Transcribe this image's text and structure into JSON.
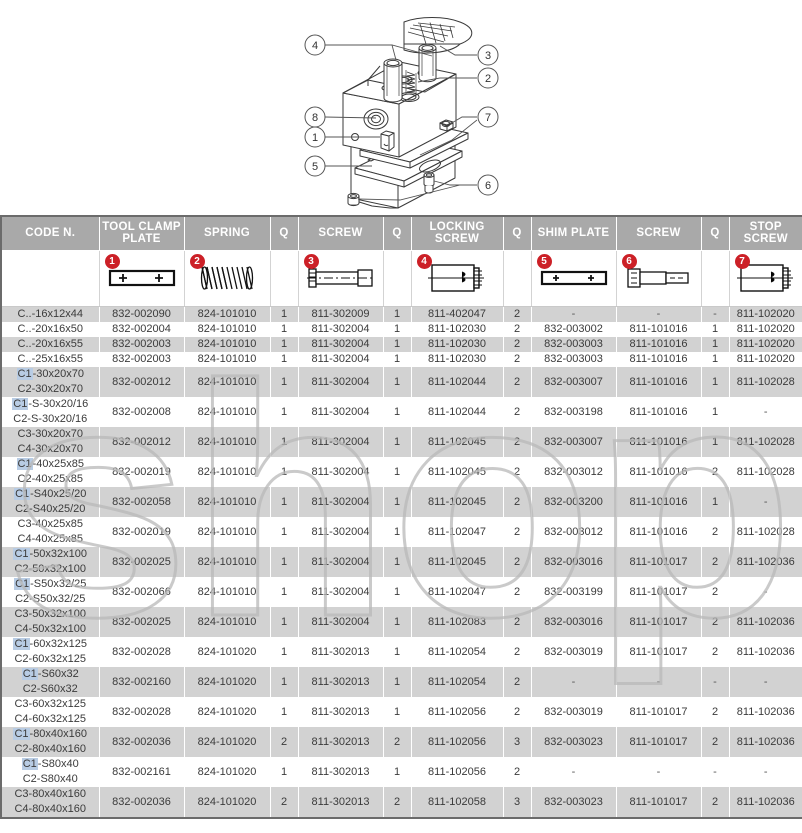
{
  "drawing": {
    "name": "tool-holder-assembly-exploded-view",
    "callouts": [
      "1",
      "2",
      "3",
      "4",
      "5",
      "6",
      "7",
      "8"
    ]
  },
  "watermark": {
    "text": "shop"
  },
  "table": {
    "columns": [
      {
        "label": "CODE N.",
        "badge": null,
        "icon": null
      },
      {
        "label": "TOOL CLAMP PLATE",
        "badge": "1",
        "icon": "clamp-plate-icon"
      },
      {
        "label": "SPRING",
        "badge": "2",
        "icon": "spring-icon"
      },
      {
        "label": "Q",
        "badge": null,
        "icon": null
      },
      {
        "label": "SCREW",
        "badge": "3",
        "icon": "screw-icon"
      },
      {
        "label": "Q",
        "badge": null,
        "icon": null
      },
      {
        "label": "LOCKING SCREW",
        "badge": "4",
        "icon": "locking-screw-icon"
      },
      {
        "label": "Q",
        "badge": null,
        "icon": null
      },
      {
        "label": "SHIM PLATE",
        "badge": "5",
        "icon": "shim-plate-icon"
      },
      {
        "label": "SCREW",
        "badge": "6",
        "icon": "socket-screw-icon"
      },
      {
        "label": "Q",
        "badge": null,
        "icon": null
      },
      {
        "label": "STOP SCREW",
        "badge": "7",
        "icon": "stop-screw-icon"
      }
    ],
    "rows": [
      {
        "codes": [
          "C..-16x12x44"
        ],
        "hl": false,
        "shaded": true,
        "tall": false,
        "cells": [
          "832-002090",
          "824-101010",
          "1",
          "811-302009",
          "1",
          "811-402047",
          "2",
          "-",
          "-",
          "-",
          "811-102020"
        ]
      },
      {
        "codes": [
          "C..-20x16x50"
        ],
        "hl": false,
        "shaded": false,
        "tall": false,
        "cells": [
          "832-002004",
          "824-101010",
          "1",
          "811-302004",
          "1",
          "811-102030",
          "2",
          "832-003002",
          "811-101016",
          "1",
          "811-102020"
        ]
      },
      {
        "codes": [
          "C..-20x16x55"
        ],
        "hl": false,
        "shaded": true,
        "tall": false,
        "cells": [
          "832-002003",
          "824-101010",
          "1",
          "811-302004",
          "1",
          "811-102030",
          "2",
          "832-003003",
          "811-101016",
          "1",
          "811-102020"
        ]
      },
      {
        "codes": [
          "C..-25x16x55"
        ],
        "hl": false,
        "shaded": false,
        "tall": false,
        "cells": [
          "832-002003",
          "824-101010",
          "1",
          "811-302004",
          "1",
          "811-102030",
          "2",
          "832-003003",
          "811-101016",
          "1",
          "811-102020"
        ]
      },
      {
        "codes": [
          "C1-30x20x70",
          "C2-30x20x70"
        ],
        "hl": true,
        "shaded": true,
        "tall": true,
        "cells": [
          "832-002012",
          "824-101010",
          "1",
          "811-302004",
          "1",
          "811-102044",
          "2",
          "832-003007",
          "811-101016",
          "1",
          "811-102028"
        ]
      },
      {
        "codes": [
          "C1-S-30x20/16",
          "C2-S-30x20/16"
        ],
        "hl": true,
        "shaded": false,
        "tall": true,
        "cells": [
          "832-002008",
          "824-101010",
          "1",
          "811-302004",
          "1",
          "811-102044",
          "2",
          "832-003198",
          "811-101016",
          "1",
          "-"
        ]
      },
      {
        "codes": [
          "C3-30x20x70",
          "C4-30x20x70"
        ],
        "hl": false,
        "shaded": true,
        "tall": true,
        "cells": [
          "832-002012",
          "824-101010",
          "1",
          "811-302004",
          "1",
          "811-102045",
          "2",
          "832-003007",
          "811-101016",
          "1",
          "811-102028"
        ]
      },
      {
        "codes": [
          "C1-40x25x85",
          "C2-40x25x85"
        ],
        "hl": true,
        "shaded": false,
        "tall": true,
        "cells": [
          "832-002019",
          "824-101010",
          "1",
          "811-302004",
          "1",
          "811-102045",
          "2",
          "832-003012",
          "811-101016",
          "2",
          "811-102028"
        ]
      },
      {
        "codes": [
          "C1-S40x25/20",
          "C2-S40x25/20"
        ],
        "hl": true,
        "shaded": true,
        "tall": true,
        "cells": [
          "832-002058",
          "824-101010",
          "1",
          "811-302004",
          "1",
          "811-102045",
          "2",
          "832-003200",
          "811-101016",
          "1",
          "-"
        ]
      },
      {
        "codes": [
          "C3-40x25x85",
          "C4-40x25x85"
        ],
        "hl": false,
        "shaded": false,
        "tall": true,
        "cells": [
          "832-002019",
          "824-101010",
          "1",
          "811-302004",
          "1",
          "811-102047",
          "2",
          "832-003012",
          "811-101016",
          "2",
          "811-102028"
        ]
      },
      {
        "codes": [
          "C1-50x32x100",
          "C2-50x32x100"
        ],
        "hl": true,
        "shaded": true,
        "tall": true,
        "cells": [
          "832-002025",
          "824-101010",
          "1",
          "811-302004",
          "1",
          "811-102045",
          "2",
          "832-003016",
          "811-101017",
          "2",
          "811-102036"
        ]
      },
      {
        "codes": [
          "C1-S50x32/25",
          "C2-S50x32/25"
        ],
        "hl": true,
        "shaded": false,
        "tall": true,
        "cells": [
          "832-002066",
          "824-101010",
          "1",
          "811-302004",
          "1",
          "811-102047",
          "2",
          "832-003199",
          "811-101017",
          "2",
          "-"
        ]
      },
      {
        "codes": [
          "C3-50x32x100",
          "C4-50x32x100"
        ],
        "hl": false,
        "shaded": true,
        "tall": true,
        "cells": [
          "832-002025",
          "824-101010",
          "1",
          "811-302004",
          "1",
          "811-102083",
          "2",
          "832-003016",
          "811-101017",
          "2",
          "811-102036"
        ]
      },
      {
        "codes": [
          "C1-60x32x125",
          "C2-60x32x125"
        ],
        "hl": true,
        "shaded": false,
        "tall": true,
        "cells": [
          "832-002028",
          "824-101020",
          "1",
          "811-302013",
          "1",
          "811-102054",
          "2",
          "832-003019",
          "811-101017",
          "2",
          "811-102036"
        ]
      },
      {
        "codes": [
          "C1-S60x32",
          "C2-S60x32"
        ],
        "hl": true,
        "shaded": true,
        "tall": true,
        "cells": [
          "832-002160",
          "824-101020",
          "1",
          "811-302013",
          "1",
          "811-102054",
          "2",
          "-",
          "-",
          "-",
          "-"
        ]
      },
      {
        "codes": [
          "C3-60x32x125",
          "C4-60x32x125"
        ],
        "hl": false,
        "shaded": false,
        "tall": true,
        "cells": [
          "832-002028",
          "824-101020",
          "1",
          "811-302013",
          "1",
          "811-102056",
          "2",
          "832-003019",
          "811-101017",
          "2",
          "811-102036"
        ]
      },
      {
        "codes": [
          "C1-80x40x160",
          "C2-80x40x160"
        ],
        "hl": true,
        "shaded": true,
        "tall": true,
        "cells": [
          "832-002036",
          "824-101020",
          "2",
          "811-302013",
          "2",
          "811-102056",
          "3",
          "832-003023",
          "811-101017",
          "2",
          "811-102036"
        ]
      },
      {
        "codes": [
          "C1-S80x40",
          "C2-S80x40"
        ],
        "hl": true,
        "shaded": false,
        "tall": true,
        "cells": [
          "832-002161",
          "824-101020",
          "1",
          "811-302013",
          "1",
          "811-102056",
          "2",
          "-",
          "-",
          "-",
          "-"
        ]
      },
      {
        "codes": [
          "C3-80x40x160",
          "C4-80x40x160"
        ],
        "hl": false,
        "shaded": true,
        "tall": true,
        "cells": [
          "832-002036",
          "824-101020",
          "2",
          "811-302013",
          "2",
          "811-102058",
          "3",
          "832-003023",
          "811-101017",
          "2",
          "811-102036"
        ]
      }
    ]
  },
  "colors": {
    "header_band": "#a9a9a9",
    "badge_red": "#cc2027",
    "row_shade": "#d2d2d2",
    "code_highlight": "#b8cce4"
  }
}
